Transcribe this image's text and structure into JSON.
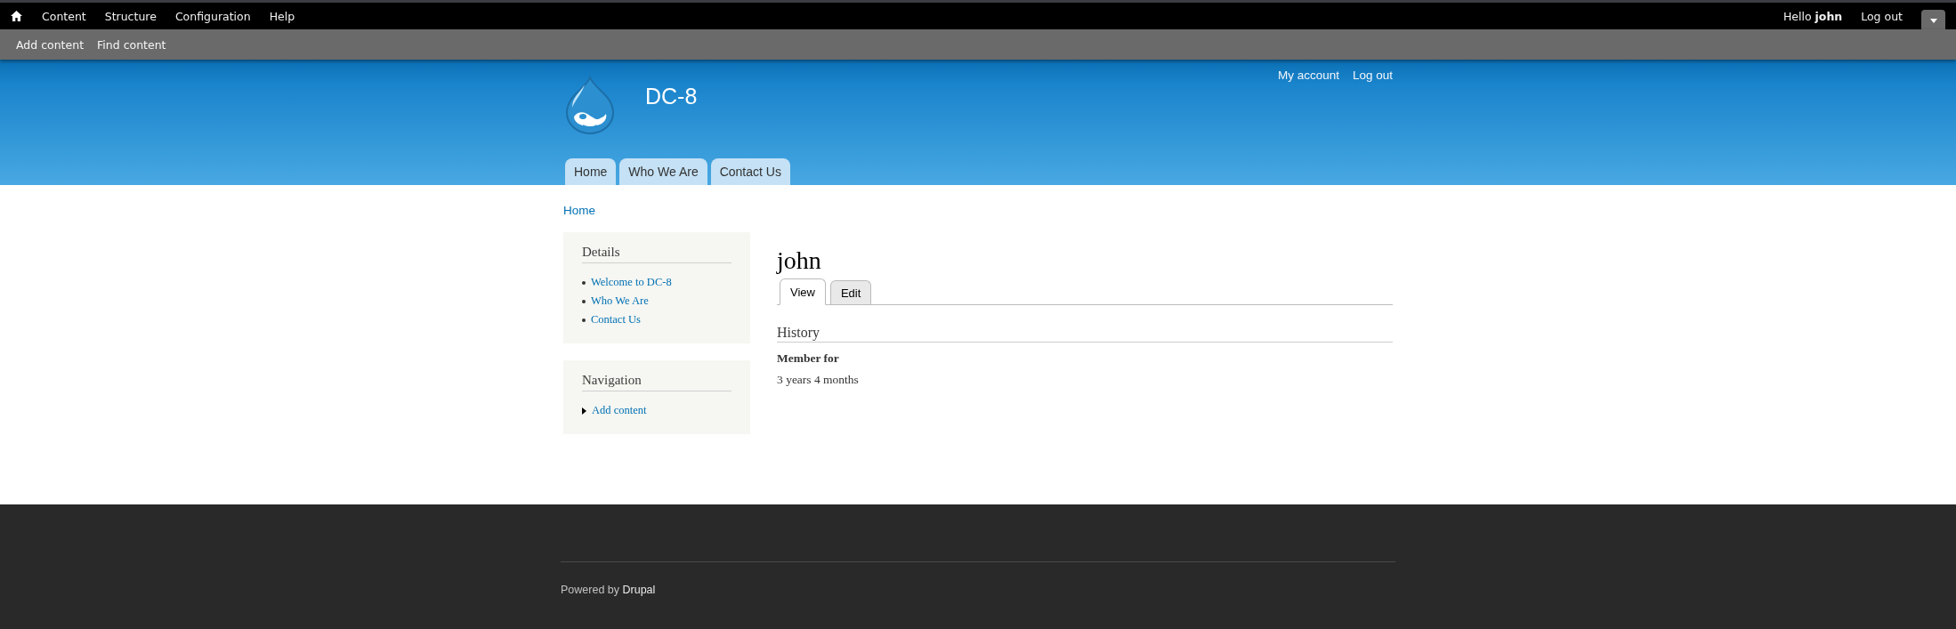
{
  "toolbar": {
    "menu": [
      "Content",
      "Structure",
      "Configuration",
      "Help"
    ],
    "user_greeting": "Hello **john**",
    "logout": "Log out"
  },
  "shortcuts": [
    "Add content",
    "Find content"
  ],
  "header": {
    "site_name": "DC-8",
    "secondary_menu": [
      "My account",
      "Log out"
    ],
    "main_menu": [
      "Home",
      "Who We Are",
      "Contact Us"
    ]
  },
  "breadcrumb": [
    "Home"
  ],
  "sidebar": [
    {
      "title": "Details",
      "kind": "bullets",
      "links": [
        "Welcome to DC-8",
        "Who We Are",
        "Contact Us"
      ]
    },
    {
      "title": "Navigation",
      "kind": "collapsed",
      "links": [
        "Add content"
      ]
    }
  ],
  "page": {
    "title": "john",
    "tabs": [
      {
        "label": "View",
        "selected": true
      },
      {
        "label": "Edit",
        "selected": false
      }
    ],
    "section": "History",
    "field_label": "Member for",
    "field_value": "3 years 4 months"
  },
  "footer": {
    "prefix": "Powered by",
    "link": "Drupal"
  }
}
